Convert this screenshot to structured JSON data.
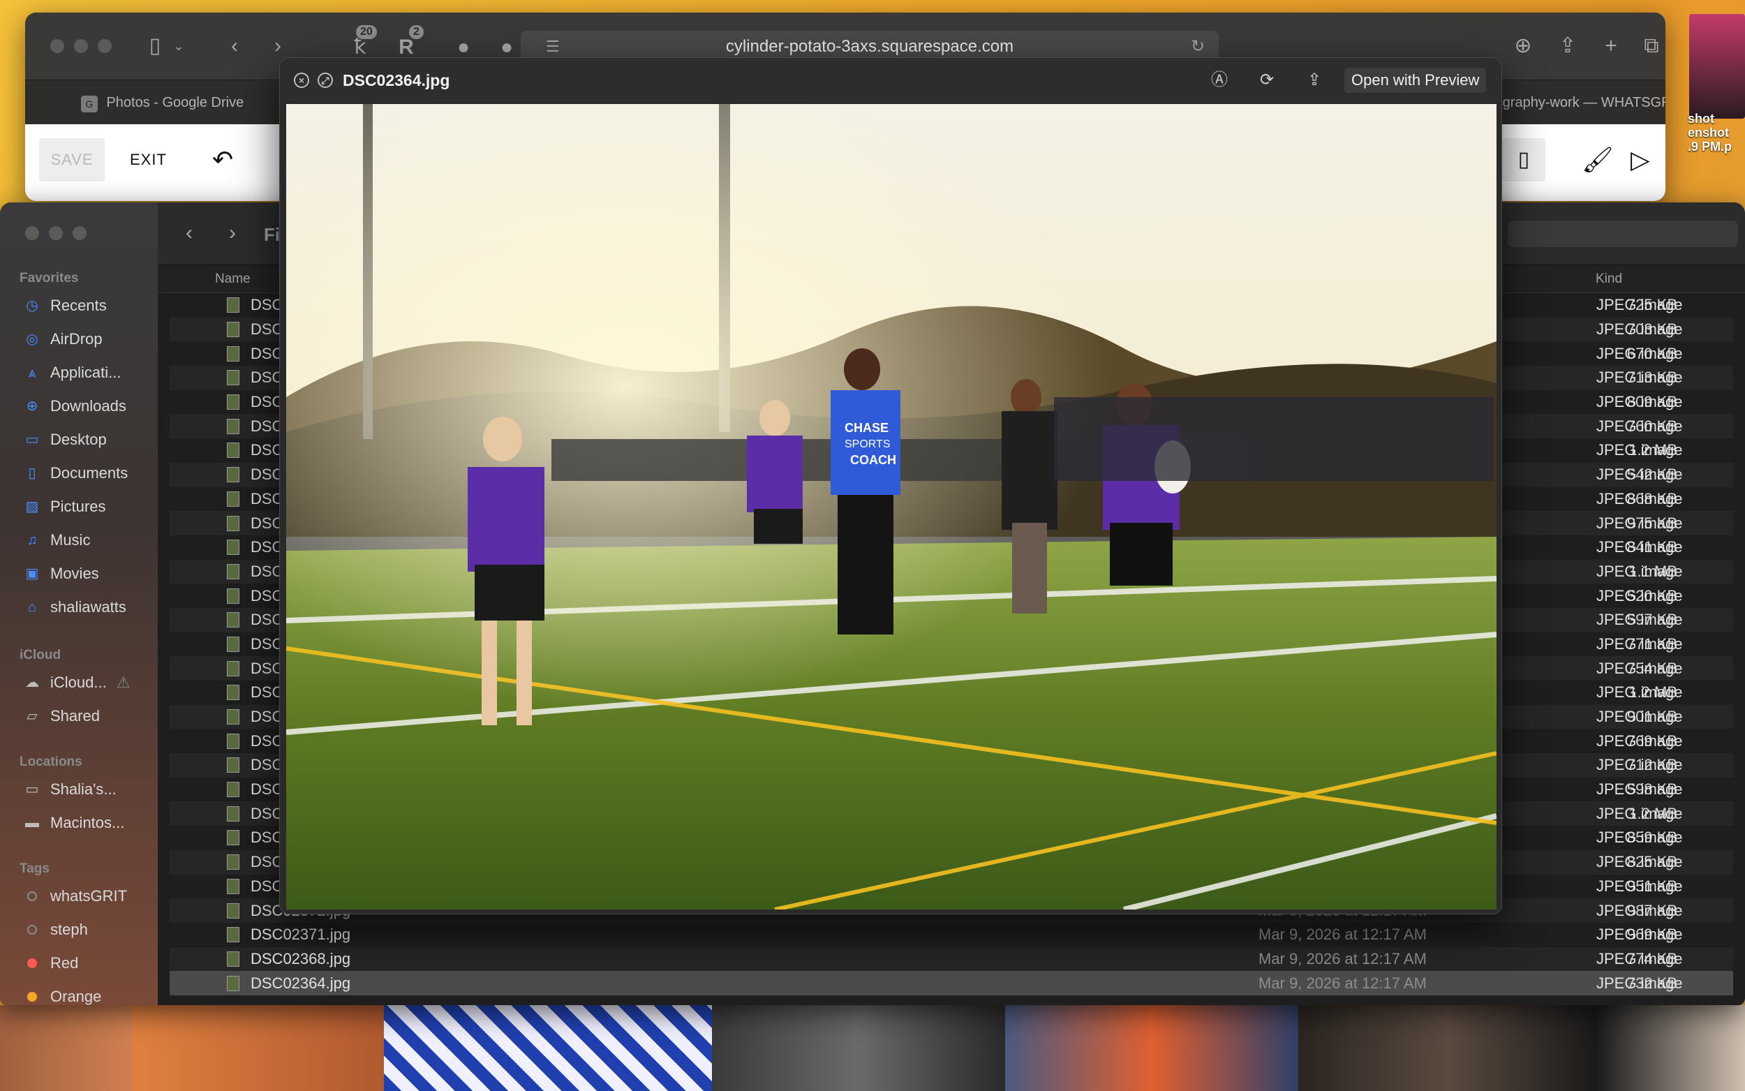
{
  "safari": {
    "url": "cylinder-potato-3axs.squarespace.com",
    "badges": [
      "20",
      "2"
    ],
    "tabs": [
      "Photos - Google Drive",
      "...graphy-work — WHATSGRI..."
    ],
    "squarespace": {
      "save": "SAVE",
      "exit": "EXIT"
    }
  },
  "desktop": {
    "thumb_label": "shot\nenshot\n.9 PM.p"
  },
  "finder": {
    "title_partial": "Fi",
    "columns": {
      "name": "Name",
      "kind": "Kind"
    },
    "sidebar": {
      "favorites_label": "Favorites",
      "favorites": [
        {
          "icon": "clock-icon",
          "label": "Recents"
        },
        {
          "icon": "airdrop-icon",
          "label": "AirDrop"
        },
        {
          "icon": "applications-icon",
          "label": "Applicati..."
        },
        {
          "icon": "download-icon",
          "label": "Downloads"
        },
        {
          "icon": "desktop-icon",
          "label": "Desktop"
        },
        {
          "icon": "document-icon",
          "label": "Documents"
        },
        {
          "icon": "pictures-icon",
          "label": "Pictures"
        },
        {
          "icon": "music-icon",
          "label": "Music"
        },
        {
          "icon": "movies-icon",
          "label": "Movies"
        },
        {
          "icon": "home-icon",
          "label": "shaliawatts"
        }
      ],
      "icloud_label": "iCloud",
      "icloud": [
        {
          "icon": "cloud-icon",
          "label": "iCloud..."
        },
        {
          "icon": "shared-folder-icon",
          "label": "Shared"
        }
      ],
      "locations_label": "Locations",
      "locations": [
        {
          "icon": "laptop-icon",
          "label": "Shalia's..."
        },
        {
          "icon": "disk-icon",
          "label": "Macintos..."
        }
      ],
      "tags_label": "Tags",
      "tags": [
        {
          "color": "#8a8a8a",
          "label": "whatsGRIT"
        },
        {
          "color": "#8a8a8a",
          "label": "steph"
        },
        {
          "color": "#ff5a52",
          "label": "Red"
        },
        {
          "color": "#f5a623",
          "label": "Orange"
        }
      ]
    },
    "rows": [
      {
        "name": "DSC",
        "date": "",
        "size": "725 KB",
        "kind": "JPEG image"
      },
      {
        "name": "DSC",
        "date": "",
        "size": "703 KB",
        "kind": "JPEG image"
      },
      {
        "name": "DSC",
        "date": "",
        "size": "670 KB",
        "kind": "JPEG image"
      },
      {
        "name": "DSC",
        "date": "",
        "size": "713 KB",
        "kind": "JPEG image"
      },
      {
        "name": "DSC",
        "date": "",
        "size": "809 KB",
        "kind": "JPEG image"
      },
      {
        "name": "DSC",
        "date": "",
        "size": "760 KB",
        "kind": "JPEG image"
      },
      {
        "name": "DSC",
        "date": "",
        "size": "1.2 MB",
        "kind": "JPEG image"
      },
      {
        "name": "DSC",
        "date": "",
        "size": "542 KB",
        "kind": "JPEG image"
      },
      {
        "name": "DSC",
        "date": "",
        "size": "868 KB",
        "kind": "JPEG image"
      },
      {
        "name": "DSC",
        "date": "",
        "size": "975 KB",
        "kind": "JPEG image"
      },
      {
        "name": "DSC",
        "date": "",
        "size": "841 KB",
        "kind": "JPEG image"
      },
      {
        "name": "DSC",
        "date": "",
        "size": "1.1 MB",
        "kind": "JPEG image"
      },
      {
        "name": "DSC",
        "date": "",
        "size": "520 KB",
        "kind": "JPEG image"
      },
      {
        "name": "DSC",
        "date": "",
        "size": "597 KB",
        "kind": "JPEG image"
      },
      {
        "name": "DSC",
        "date": "",
        "size": "771 KB",
        "kind": "JPEG image"
      },
      {
        "name": "DSC",
        "date": "",
        "size": "754 KB",
        "kind": "JPEG image"
      },
      {
        "name": "DSC",
        "date": "",
        "size": "1.2 MB",
        "kind": "JPEG image"
      },
      {
        "name": "DSC",
        "date": "",
        "size": "901 KB",
        "kind": "JPEG image"
      },
      {
        "name": "DSC",
        "date": "",
        "size": "769 KB",
        "kind": "JPEG image"
      },
      {
        "name": "DSC",
        "date": "",
        "size": "712 KB",
        "kind": "JPEG image"
      },
      {
        "name": "DSC",
        "date": "",
        "size": "598 KB",
        "kind": "JPEG image"
      },
      {
        "name": "DSC",
        "date": "",
        "size": "1.2 MB",
        "kind": "JPEG image"
      },
      {
        "name": "DSC",
        "date": "",
        "size": "859 KB",
        "kind": "JPEG image"
      },
      {
        "name": "DSC",
        "date": "",
        "size": "825 KB",
        "kind": "JPEG image"
      },
      {
        "name": "DSC",
        "date": "",
        "size": "951 KB",
        "kind": "JPEG image"
      },
      {
        "name": "DSC02372.jpg",
        "date": "Mar 9, 2026 at 12:17 AM",
        "size": "987 KB",
        "kind": "JPEG image"
      },
      {
        "name": "DSC02371.jpg",
        "date": "Mar 9, 2026 at 12:17 AM",
        "size": "969 KB",
        "kind": "JPEG image"
      },
      {
        "name": "DSC02368.jpg",
        "date": "Mar 9, 2026 at 12:17 AM",
        "size": "774 KB",
        "kind": "JPEG image"
      },
      {
        "name": "DSC02364.jpg",
        "date": "Mar 9, 2026 at 12:17 AM",
        "size": "732 KB",
        "kind": "JPEG image",
        "selected": true
      }
    ]
  },
  "quicklook": {
    "filename": "DSC02364.jpg",
    "open_with": "Open with Preview",
    "jersey_text": [
      "CHASE",
      "SPORTS",
      "COACH"
    ]
  },
  "colors": {
    "accent": "#4a8dff",
    "selection": "#4b4b4d"
  }
}
